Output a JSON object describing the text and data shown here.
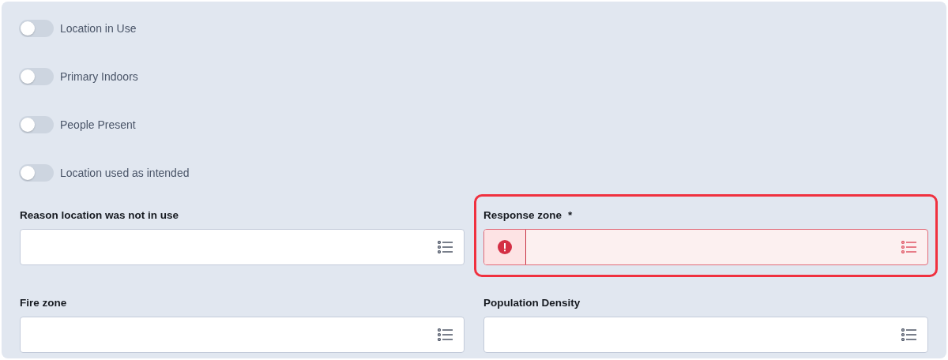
{
  "toggles": [
    {
      "label": "Location in Use",
      "on": false
    },
    {
      "label": "Primary Indoors",
      "on": false
    },
    {
      "label": "People Present",
      "on": false
    },
    {
      "label": "Location used as intended",
      "on": false
    }
  ],
  "fields": [
    {
      "label": "Reason location was not in use",
      "error": false
    },
    {
      "label": "Response zone",
      "marker": "*",
      "error": true
    },
    {
      "label": "Fire zone",
      "error": false
    },
    {
      "label": "Population Density",
      "error": false
    }
  ]
}
